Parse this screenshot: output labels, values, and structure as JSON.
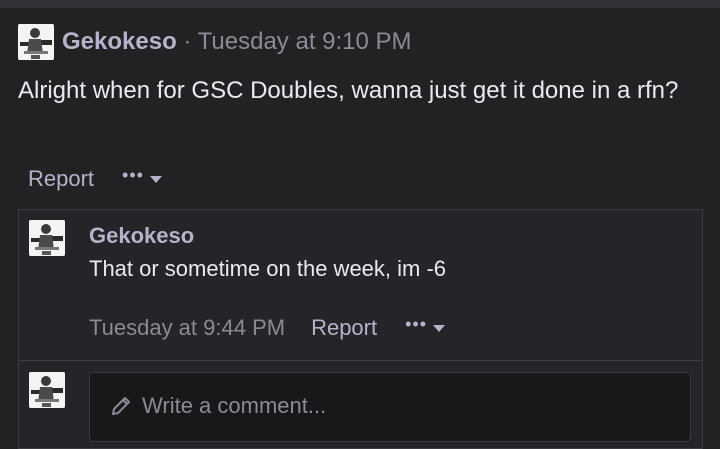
{
  "post": {
    "username": "Gekokeso",
    "separator": "·",
    "timestamp": "Tuesday at 9:10 PM",
    "body": "Alright when for GSC Doubles, wanna just get it done in a rfn?",
    "report_label": "Report",
    "more_label": "•••"
  },
  "reply": {
    "username": "Gekokeso",
    "body": "That or sometime on the week, im -6",
    "timestamp": "Tuesday at 9:44 PM",
    "report_label": "Report",
    "more_label": "•••"
  },
  "comment_box": {
    "placeholder": "Write a comment..."
  },
  "colors": {
    "background": "#222124",
    "username": "#b7b1c9",
    "muted": "#8d8a93",
    "text": "#ece9f0"
  }
}
